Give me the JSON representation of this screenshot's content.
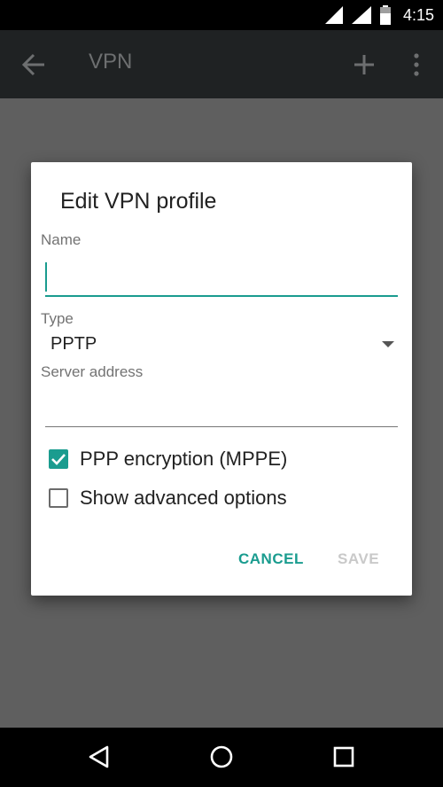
{
  "status_bar": {
    "time": "4:15"
  },
  "app_bar": {
    "title": "VPN",
    "icons": [
      "arrow-left-icon",
      "plus-icon",
      "more-vert-icon"
    ]
  },
  "dialog": {
    "title": "Edit VPN profile",
    "name": {
      "label": "Name",
      "value": ""
    },
    "type": {
      "label": "Type",
      "value": "PPTP"
    },
    "server": {
      "label": "Server address",
      "value": ""
    },
    "options": {
      "ppp_encryption": {
        "label": "PPP encryption (MPPE)",
        "checked": true
      },
      "show_advanced": {
        "label": "Show advanced options",
        "checked": false
      }
    },
    "buttons": {
      "cancel": "CANCEL",
      "save": "SAVE"
    }
  },
  "colors": {
    "accent": "#1a9c8f",
    "dim_background": "#5f5f5f",
    "disabled_text": "#c9c9c9"
  }
}
